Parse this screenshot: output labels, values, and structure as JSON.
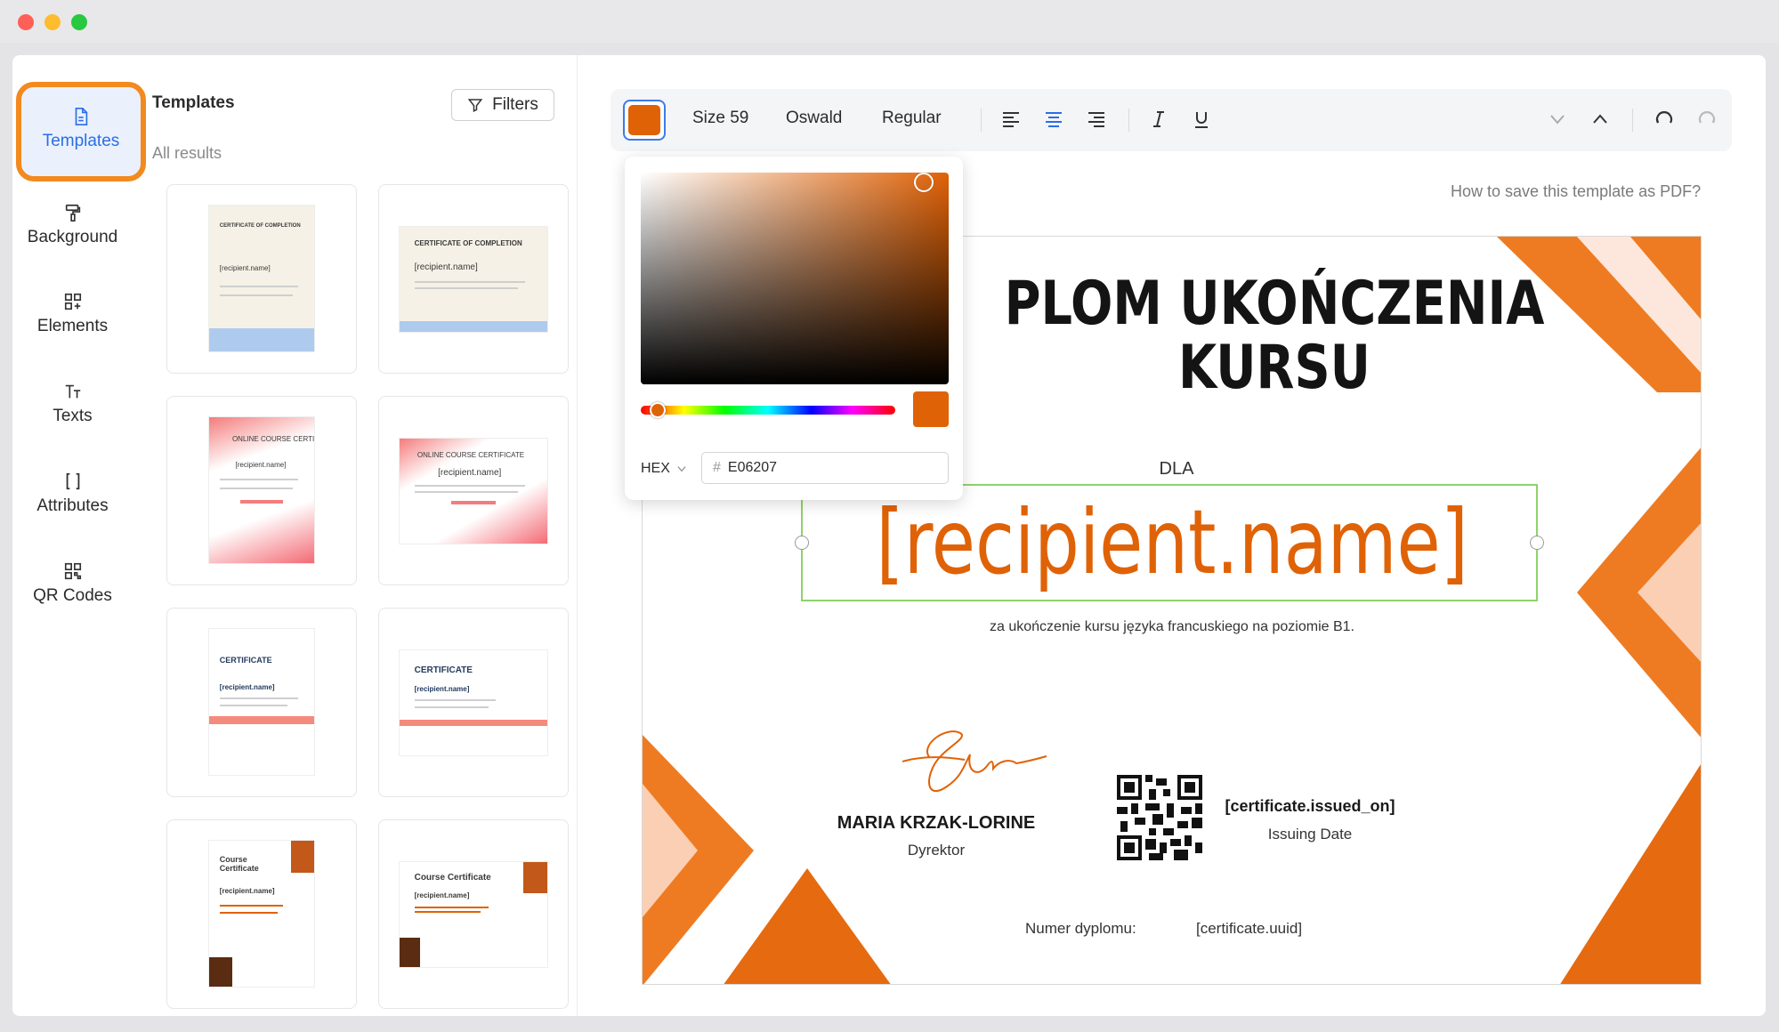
{
  "sidebar": {
    "items": [
      {
        "label": "Templates",
        "icon": "file-icon",
        "active": true
      },
      {
        "label": "Background",
        "icon": "paint-roller-icon"
      },
      {
        "label": "Elements",
        "icon": "elements-grid-icon"
      },
      {
        "label": "Texts",
        "icon": "text-icon"
      },
      {
        "label": "Attributes",
        "icon": "brackets-icon"
      },
      {
        "label": "QR Codes",
        "icon": "qr-icon"
      }
    ]
  },
  "panel": {
    "title": "Templates",
    "filters_label": "Filters",
    "results_label": "All results"
  },
  "thumbnails": [
    {
      "title": "CERTIFICATE OF COMPLETION",
      "name": "[recipient.name]"
    },
    {
      "title": "CERTIFICATE OF COMPLETION",
      "name": "[recipient.name]"
    },
    {
      "title": "ONLINE COURSE CERTIFICATE",
      "name": "[recipient.name]"
    },
    {
      "title": "ONLINE COURSE CERTIFICATE",
      "name": "[recipient.name]"
    },
    {
      "title": "CERTIFICATE",
      "name": "[recipient.name]"
    },
    {
      "title": "CERTIFICATE",
      "name": "[recipient.name]"
    },
    {
      "title": "Course Certificate",
      "name": "[recipient.name]"
    },
    {
      "title": "Course Certificate",
      "name": "[recipient.name]"
    }
  ],
  "toolbar": {
    "color": "#E06207",
    "size_label": "Size 59",
    "font_label": "Oswald",
    "weight_label": "Regular"
  },
  "picker": {
    "format_label": "HEX",
    "hex_value": "E06207",
    "hash": "#"
  },
  "help": {
    "link": "How to save this template as PDF?"
  },
  "certificate": {
    "title_line1": "PLOM UKOŃCZENIA",
    "title_line2": "KURSU",
    "dla": "DLA",
    "recipient": "[recipient.name]",
    "description": "za ukończenie kursu języka francuskiego na poziomie B1.",
    "signer_name": "MARIA KRZAK-LORINE",
    "signer_role": "Dyrektor",
    "issued_placeholder": "[certificate.issued_on]",
    "issued_label": "Issuing Date",
    "number_label": "Numer dyplomu:",
    "uuid_placeholder": "[certificate.uuid]"
  },
  "colors": {
    "accent": "#e06207",
    "highlight": "#f28a1e",
    "selection": "#8ed36b",
    "active_nav": "#2a6ee8"
  }
}
